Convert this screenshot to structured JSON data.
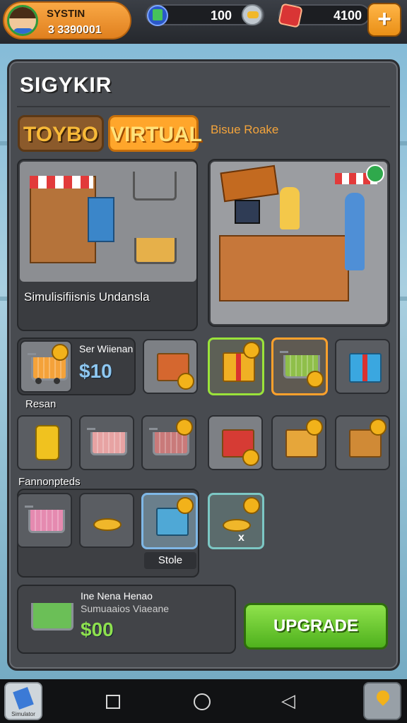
{
  "header": {
    "player_name": "SYSTIN",
    "player_level": "3 3390001",
    "cash_value": "100",
    "gems_value": "4100",
    "add_button": "+"
  },
  "panel": {
    "title": "SIGYKIR",
    "tabs": [
      {
        "label": "TOYBO",
        "active": false
      },
      {
        "label": "VIRTUAL",
        "active": true
      }
    ],
    "tab_hint": "Bisue Roake"
  },
  "cards": {
    "left_scene_label": "Simulisifiisnis Undansla",
    "shop_item": {
      "title": "Ser Wiienan",
      "price": "$10"
    },
    "section_label_1": "Resan",
    "section_label_2": "Fannonpteds",
    "store_tag": "Stole",
    "bottom_offer": {
      "title": "Ine Nena Henao",
      "subtitle": "Sumuaaios Viaeane",
      "price": "$00"
    },
    "upgrade_label": "UPGRADE",
    "tile_badge": "x"
  },
  "nav": {
    "app_label": "Simulator"
  },
  "colors": {
    "accent_orange": "#ffa62b",
    "panel_bg": "#484b50",
    "upgrade_green": "#4fb11d",
    "tab_inactive": "#8b5a2b"
  },
  "icons": [
    "avatar",
    "cash-icon",
    "gold-coin-icon",
    "gem-icon",
    "plus-icon",
    "cart-icon",
    "gift-icon",
    "jar-icon",
    "coins-icon",
    "box-icon",
    "square-nav-icon",
    "circle-nav-icon",
    "back-nav-icon",
    "map-icon"
  ]
}
